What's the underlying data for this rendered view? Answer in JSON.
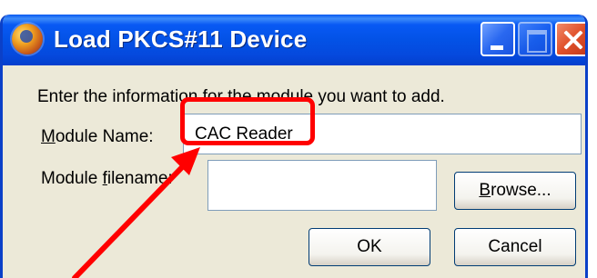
{
  "window": {
    "title": "Load PKCS#11 Device",
    "icon": "firefox-icon",
    "controls": [
      "minimize-icon",
      "maximize-icon",
      "close-icon"
    ]
  },
  "form": {
    "intro": "Enter the information for the module you want to add.",
    "module_name_label": "Module Name:",
    "module_name_value": "CAC Reader",
    "module_filename_label": "Module filename:",
    "module_filename_value": ""
  },
  "buttons": {
    "browse": "Browse...",
    "ok": "OK",
    "cancel": "Cancel"
  },
  "annotation": {
    "color": "#ff0000",
    "type": "highlight-box-with-arrow"
  }
}
